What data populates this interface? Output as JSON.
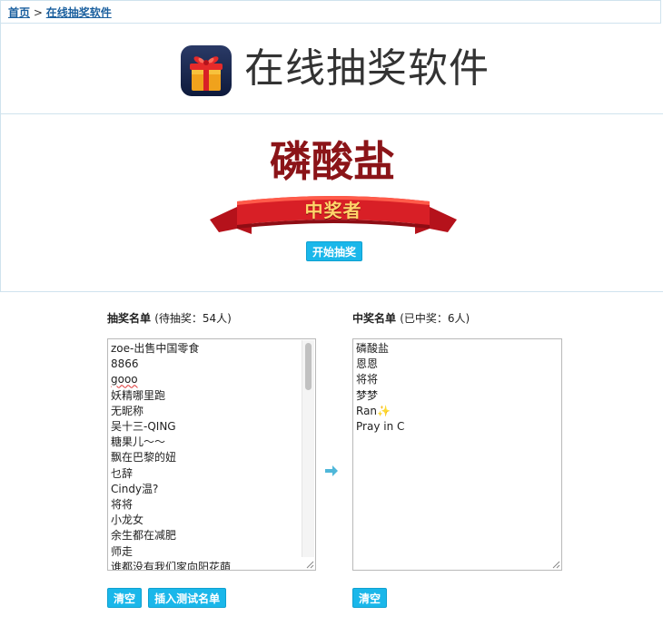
{
  "breadcrumb": {
    "home": "首页",
    "separator": ">",
    "current": "在线抽奖软件"
  },
  "header": {
    "title": "在线抽奖软件",
    "icon": "gift-box-icon"
  },
  "winner": {
    "name": "磷酸盐",
    "ribbon_label": "中奖者",
    "start_button": "开始抽奖"
  },
  "pool": {
    "title": "抽奖名单",
    "subtitle": "(待抽奖：54人)",
    "entries": [
      "zoe-出售中国零食",
      "8866",
      "gooo",
      "妖精哪里跑",
      "无昵称",
      "吴十三-QING",
      "糖果儿～～",
      "飘在巴黎的妞",
      "乜辞",
      "Cindy温?",
      "将将",
      "小龙女",
      "余生都在减肥",
      "师走",
      "谁都没有我们家向阳花萌"
    ],
    "clear_button": "清空",
    "insert_button": "插入测试名单"
  },
  "winners": {
    "title": "中奖名单",
    "subtitle": "(已中奖：6人)",
    "entries": [
      "磷酸盐",
      "恩恩",
      "将将",
      "梦梦",
      "Ran✨",
      "Pray in C"
    ],
    "clear_button": "清空"
  },
  "colors": {
    "accent": "#1ab7ea",
    "winner_text": "#8b1418",
    "link": "#1a5f9e"
  }
}
